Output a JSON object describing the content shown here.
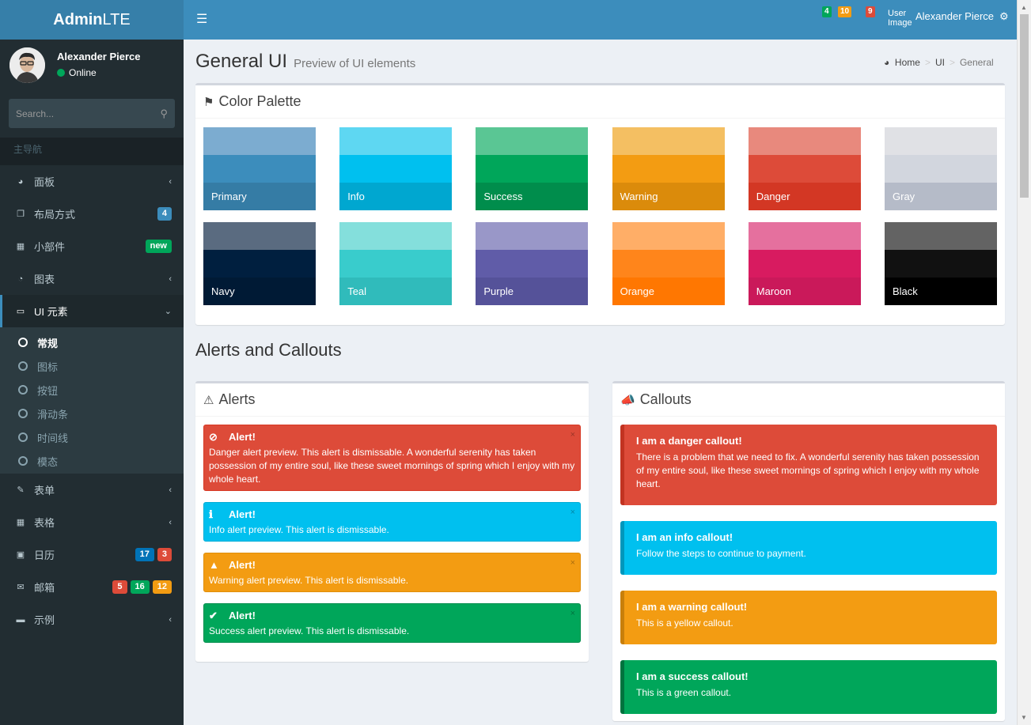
{
  "app": {
    "logo_bold": "Admin",
    "logo_rest": "LTE"
  },
  "user": {
    "name": "Alexander Pierce",
    "status": "Online"
  },
  "search": {
    "placeholder": "Search..."
  },
  "sidebar": {
    "header": "主导航",
    "items": [
      {
        "icon": "dashboard-icon",
        "label": "面板",
        "chevron": "‹"
      },
      {
        "icon": "files-icon",
        "label": "布局方式",
        "badges": [
          {
            "text": "4",
            "color": "#3c8dbc"
          }
        ]
      },
      {
        "icon": "th-icon",
        "label": "小部件",
        "badges": [
          {
            "text": "new",
            "color": "#00a65a"
          }
        ]
      },
      {
        "icon": "pie-chart-icon",
        "label": "图表",
        "chevron": "‹"
      },
      {
        "icon": "laptop-icon",
        "label": "UI 元素",
        "chevron": "⌄",
        "active": true
      },
      {
        "icon": "edit-icon",
        "label": "表单",
        "chevron": "‹"
      },
      {
        "icon": "table-icon",
        "label": "表格",
        "chevron": "‹"
      },
      {
        "icon": "calendar-icon",
        "label": "日历",
        "badges": [
          {
            "text": "17",
            "color": "#0073b7"
          },
          {
            "text": "3",
            "color": "#dd4b39"
          }
        ]
      },
      {
        "icon": "envelope-icon",
        "label": "邮箱",
        "badges": [
          {
            "text": "5",
            "color": "#dd4b39"
          },
          {
            "text": "16",
            "color": "#00a65a"
          },
          {
            "text": "12",
            "color": "#f39c12"
          }
        ]
      },
      {
        "icon": "folder-icon",
        "label": "示例",
        "chevron": "‹"
      }
    ],
    "submenu": [
      "常规",
      "图标",
      "按钮",
      "滑动条",
      "时间线",
      "模态"
    ],
    "submenu_current": 0
  },
  "navbar": {
    "messages_count": "4",
    "notifications_count": "10",
    "tasks_count": "9",
    "user_image_alt": "User Image",
    "user_name": "Alexander Pierce"
  },
  "page": {
    "title": "General UI",
    "subtitle": "Preview of UI elements",
    "breadcrumb": [
      "Home",
      "UI",
      "General"
    ]
  },
  "palette": {
    "title": "Color Palette",
    "colors": [
      {
        "label": "Primary",
        "shades": [
          "#7cacd0",
          "#3c8dbc",
          "#357ca5"
        ]
      },
      {
        "label": "Info",
        "shades": [
          "#5ed7f2",
          "#00c0ef",
          "#00a7d0"
        ]
      },
      {
        "label": "Success",
        "shades": [
          "#5ac694",
          "#00a65a",
          "#008d4c"
        ]
      },
      {
        "label": "Warning",
        "shades": [
          "#f4bf62",
          "#f39c12",
          "#db8b0b"
        ]
      },
      {
        "label": "Danger",
        "shades": [
          "#e8897d",
          "#dd4b39",
          "#d33724"
        ]
      },
      {
        "label": "Gray",
        "shades": [
          "#e0e1e5",
          "#d2d6de",
          "#b5bbc8"
        ]
      },
      {
        "label": "Navy",
        "shades": [
          "#5a6b80",
          "#001f3f",
          "#001a35"
        ]
      },
      {
        "label": "Teal",
        "shades": [
          "#84dfdc",
          "#39cccc",
          "#30bbbb"
        ]
      },
      {
        "label": "Purple",
        "shades": [
          "#9997c8",
          "#605ca8",
          "#555299"
        ]
      },
      {
        "label": "Orange",
        "shades": [
          "#ffae67",
          "#ff851b",
          "#ff7701"
        ]
      },
      {
        "label": "Maroon",
        "shades": [
          "#e5709e",
          "#d81b60",
          "#ca195a"
        ]
      },
      {
        "label": "Black",
        "shades": [
          "#636363",
          "#111111",
          "#000000"
        ]
      }
    ]
  },
  "alerts_section": {
    "title": "Alerts and Callouts"
  },
  "alerts": {
    "title": "Alerts",
    "items": [
      {
        "type": "danger",
        "icon": "ban-icon",
        "glyph": "⊘",
        "heading": "Alert!",
        "text": "Danger alert preview. This alert is dismissable. A wonderful serenity has taken possession of my entire soul, like these sweet mornings of spring which I enjoy with my whole heart.",
        "bg": "#dd4b39",
        "border": "#d73925"
      },
      {
        "type": "info",
        "icon": "info-icon",
        "glyph": "ℹ",
        "heading": "Alert!",
        "text": "Info alert preview. This alert is dismissable.",
        "bg": "#00c0ef",
        "border": "#00acd6"
      },
      {
        "type": "warning",
        "icon": "warning-icon",
        "glyph": "▲",
        "heading": "Alert!",
        "text": "Warning alert preview. This alert is dismissable.",
        "bg": "#f39c12",
        "border": "#e08e0b"
      },
      {
        "type": "success",
        "icon": "check-icon",
        "glyph": "✔",
        "heading": "Alert!",
        "text": "Success alert preview. This alert is dismissable.",
        "bg": "#00a65a",
        "border": "#008d4c"
      }
    ],
    "close": "×"
  },
  "callouts": {
    "title": "Callouts",
    "items": [
      {
        "type": "danger",
        "heading": "I am a danger callout!",
        "text": "There is a problem that we need to fix. A wonderful serenity has taken possession of my entire soul, like these sweet mornings of spring which I enjoy with my whole heart.",
        "bg": "#dd4b39",
        "border": "#c23321"
      },
      {
        "type": "info",
        "heading": "I am an info callout!",
        "text": "Follow the steps to continue to payment.",
        "bg": "#00c0ef",
        "border": "#0097bc"
      },
      {
        "type": "warning",
        "heading": "I am a warning callout!",
        "text": "This is a yellow callout.",
        "bg": "#f39c12",
        "border": "#c87f0a"
      },
      {
        "type": "success",
        "heading": "I am a success callout!",
        "text": "This is a green callout.",
        "bg": "#00a65a",
        "border": "#00733e"
      }
    ]
  }
}
